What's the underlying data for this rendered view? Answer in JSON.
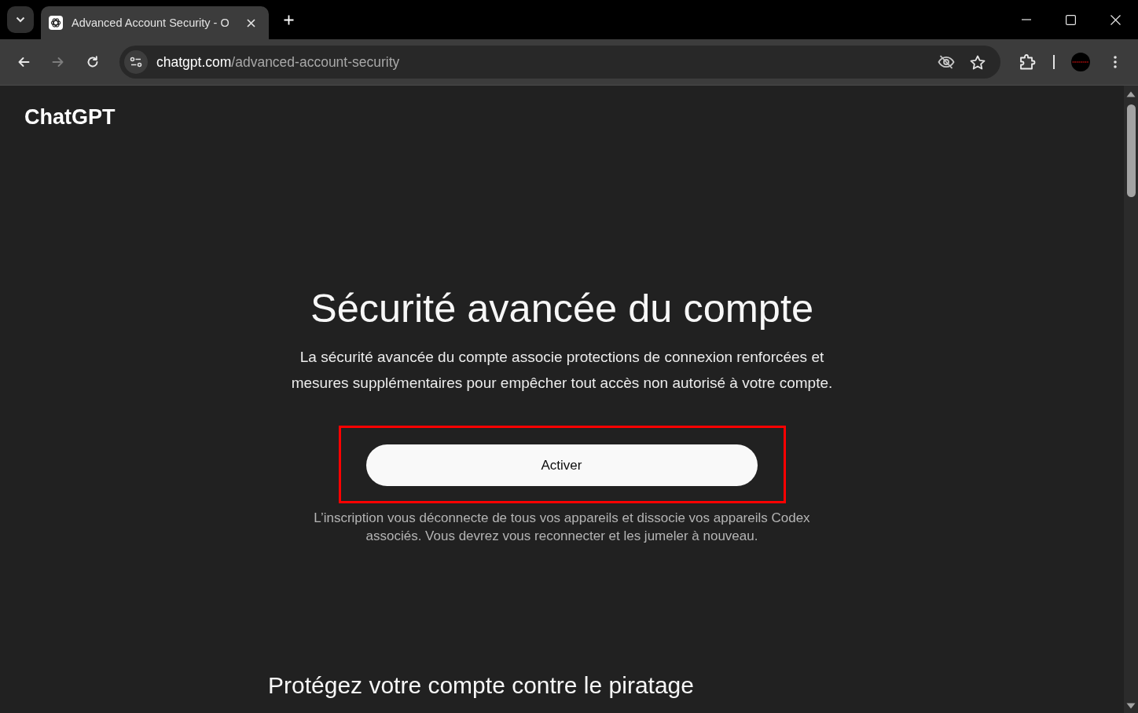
{
  "browser": {
    "tabs": [
      {
        "title": "Advanced Account Security - O",
        "selected": true
      }
    ],
    "nav_buttons": [
      {
        "kind": "back",
        "disabled": false
      },
      {
        "kind": "forward",
        "disabled": true
      },
      {
        "kind": "reload",
        "disabled": false
      }
    ],
    "address_bar": {
      "host": "chatgpt.com",
      "path": "/advanced-account-security"
    }
  },
  "page": {
    "logo": "ChatGPT",
    "title": "Sécurité avancée du compte",
    "description": "La sécurité avancée du compte associe protections de connexion renforcées et mesures supplémentaires pour empêcher tout accès non autorisé à votre compte.",
    "activate_button": {
      "label": "Activer",
      "highlighted": true
    },
    "note": "L’inscription vous déconnecte de tous vos appareils et dissocie vos appareils Codex associés. Vous devrez vous reconnecter et les jumeler à nouveau.",
    "section_title": "Protégez votre compte contre le piratage"
  }
}
